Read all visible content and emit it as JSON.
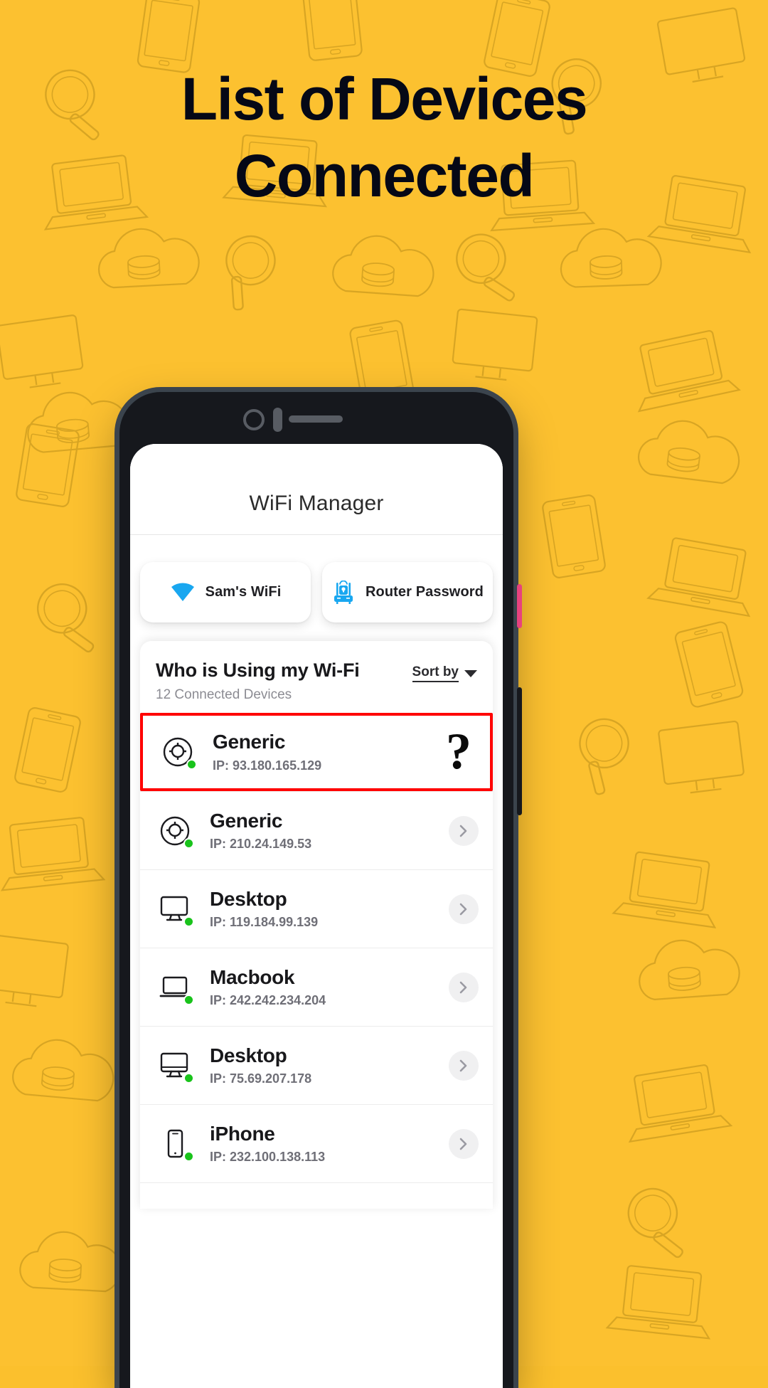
{
  "promo": {
    "headline_line1": "List of Devices",
    "headline_line2": "Connected",
    "background_color": "#FCC130",
    "headline_color": "#050816"
  },
  "app": {
    "title": "WiFi Manager",
    "tabs": [
      {
        "label": "Sam's WiFi",
        "icon": "wifi-icon",
        "active": true
      },
      {
        "label": "Router Password",
        "icon": "router-lock-icon",
        "active": false
      }
    ],
    "accent_color": "#1BA6F0"
  },
  "device_card": {
    "title": "Who is Using my Wi-Fi",
    "subtitle": "12 Connected Devices",
    "sort_label": "Sort by",
    "sort_icon": "chevron-down-icon",
    "highlight_color": "#FF0000",
    "online_color": "#19C31B",
    "devices": [
      {
        "name": "Generic",
        "ip": "IP: 93.180.165.129",
        "icon": "generic-device-icon",
        "online": true,
        "action": "question-mark",
        "highlighted": true
      },
      {
        "name": "Generic",
        "ip": "IP: 210.24.149.53",
        "icon": "generic-device-icon",
        "online": true,
        "action": "chevron-right-icon",
        "highlighted": false
      },
      {
        "name": "Desktop",
        "ip": "IP: 119.184.99.139",
        "icon": "monitor-icon",
        "online": true,
        "action": "chevron-right-icon",
        "highlighted": false
      },
      {
        "name": "Macbook",
        "ip": "IP: 242.242.234.204",
        "icon": "laptop-icon",
        "online": true,
        "action": "chevron-right-icon",
        "highlighted": false
      },
      {
        "name": "Desktop",
        "ip": "IP: 75.69.207.178",
        "icon": "imac-icon",
        "online": true,
        "action": "chevron-right-icon",
        "highlighted": false
      },
      {
        "name": "iPhone",
        "ip": "IP: 232.100.138.113",
        "icon": "phone-icon",
        "online": true,
        "action": "chevron-right-icon",
        "highlighted": false
      }
    ],
    "question_mark": "?"
  }
}
